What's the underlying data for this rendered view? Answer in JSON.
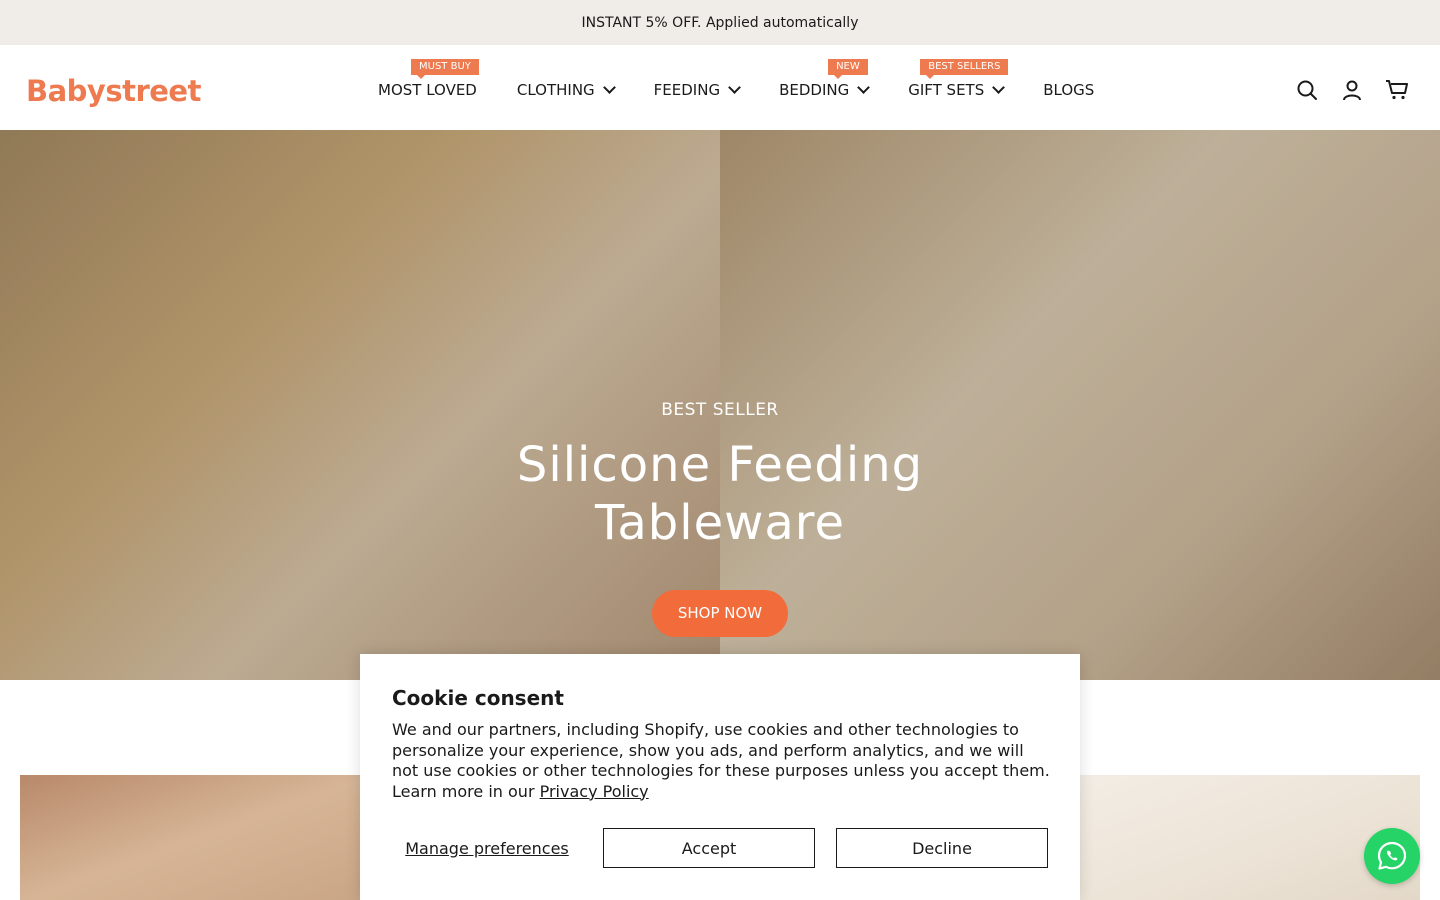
{
  "announcement": {
    "text": "INSTANT 5% OFF. Applied automatically"
  },
  "header": {
    "logo_text": "Babystreet",
    "nav": [
      {
        "label": "MOST LOVED",
        "badge": "MUST BUY",
        "has_dropdown": false
      },
      {
        "label": "CLOTHING",
        "badge": "",
        "has_dropdown": true
      },
      {
        "label": "FEEDING",
        "badge": "",
        "has_dropdown": true
      },
      {
        "label": "BEDDING",
        "badge": "NEW",
        "has_dropdown": true
      },
      {
        "label": "GIFT SETS",
        "badge": "BEST SELLERS",
        "has_dropdown": true
      },
      {
        "label": "BLOGS",
        "badge": "",
        "has_dropdown": false
      }
    ],
    "icons": [
      "search-icon",
      "account-icon",
      "cart-icon"
    ]
  },
  "hero": {
    "subtitle": "BEST SELLER",
    "title_line1": "Silicone Feeding",
    "title_line2": "Tableware",
    "cta_label": "SHOP NOW"
  },
  "cookie": {
    "title": "Cookie consent",
    "body": "We and our partners, including Shopify, use cookies and other technologies to personalize your experience, show you ads, and perform analytics, and we will not use cookies or other technologies for these purposes unless you accept them. Learn more in our ",
    "link_text": "Privacy Policy",
    "manage_label": "Manage preferences",
    "accept_label": "Accept",
    "decline_label": "Decline"
  },
  "floating": {
    "whatsapp_icon": "whatsapp-icon"
  },
  "colors": {
    "brand": "#ee7a4f",
    "cta": "#f26b3a",
    "announcement_bg": "#f0ede8",
    "whatsapp": "#25d366"
  }
}
